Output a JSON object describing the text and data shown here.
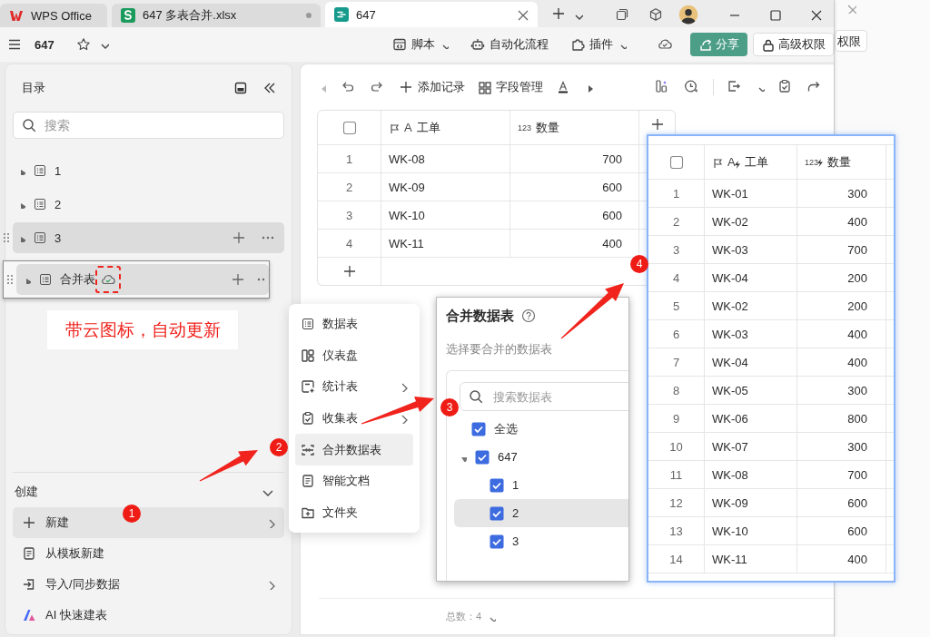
{
  "tabs": [
    {
      "kind": "home",
      "label": "WPS Office",
      "selected": false
    },
    {
      "kind": "sheet",
      "label": "647 多表合并.xlsx",
      "selected": false
    },
    {
      "kind": "base",
      "label": "647",
      "selected": true
    }
  ],
  "header": {
    "title": "647",
    "actions": [
      {
        "kind": "script",
        "label": "脚本",
        "dropdown": true
      },
      {
        "kind": "robot",
        "label": "自动化流程",
        "dropdown": false
      },
      {
        "kind": "plugin",
        "label": "插件",
        "dropdown": true
      }
    ],
    "share": "分享",
    "permissions": "高级权限"
  },
  "background_window": {
    "button": "权限"
  },
  "sidebar": {
    "title": "目录",
    "search": {
      "placeholder": "搜索"
    },
    "items": [
      {
        "label": "1",
        "selected": false
      },
      {
        "label": "2",
        "selected": false
      },
      {
        "label": "3",
        "selected": true
      }
    ],
    "create": {
      "title": "创建",
      "items": [
        {
          "kind": "plus",
          "label": "新建",
          "submenu": true,
          "selected": true
        },
        {
          "kind": "template",
          "label": "从模板新建",
          "submenu": false,
          "selected": false
        },
        {
          "kind": "import",
          "label": "导入/同步数据",
          "submenu": true,
          "selected": false
        },
        {
          "kind": "ai",
          "label": "AI 快速建表",
          "submenu": false,
          "selected": false
        }
      ]
    }
  },
  "dragged_item": {
    "label": "合并表",
    "synced": true
  },
  "annotation": "带云图标，自动更新",
  "view_toolbar": {
    "add_record": "添加记录",
    "fields": "字段管理"
  },
  "table": {
    "columns": [
      {
        "kind": "text",
        "type_label": "A",
        "label": "工单"
      },
      {
        "kind": "number",
        "type_label": "123",
        "label": "数量"
      }
    ],
    "rows": [
      {
        "index": "1",
        "cells": [
          "WK-08",
          "700"
        ]
      },
      {
        "index": "2",
        "cells": [
          "WK-09",
          "600"
        ]
      },
      {
        "index": "3",
        "cells": [
          "WK-10",
          "600"
        ]
      },
      {
        "index": "4",
        "cells": [
          "WK-11",
          "400"
        ]
      }
    ]
  },
  "footer": {
    "total": "总数：4"
  },
  "new_menu": {
    "items": [
      {
        "kind": "sheet",
        "label": "数据表",
        "submenu": false,
        "selected": false
      },
      {
        "kind": "dashboard",
        "label": "仪表盘",
        "submenu": false,
        "selected": false
      },
      {
        "kind": "stats",
        "label": "统计表",
        "submenu": true,
        "selected": false
      },
      {
        "kind": "form",
        "label": "收集表",
        "submenu": true,
        "selected": false
      },
      {
        "kind": "merge",
        "label": "合并数据表",
        "submenu": false,
        "selected": true
      },
      {
        "kind": "doc",
        "label": "智能文档",
        "submenu": false,
        "selected": false
      },
      {
        "kind": "folder",
        "label": "文件夹",
        "submenu": false,
        "selected": false
      }
    ]
  },
  "merge_dialog": {
    "title": "合并数据表",
    "hint": "选择要合并的数据表",
    "search": {
      "placeholder": "搜索数据表"
    },
    "select_all": {
      "label": "全选",
      "checked": true
    },
    "tree": [
      {
        "label": "647",
        "checked": true,
        "expanded": true,
        "selected": false,
        "children": [
          {
            "label": "1",
            "checked": true,
            "selected": false
          },
          {
            "label": "2",
            "checked": true,
            "selected": true
          },
          {
            "label": "3",
            "checked": true,
            "selected": false
          }
        ]
      }
    ]
  },
  "merged_table": {
    "synced": true,
    "columns": [
      {
        "kind": "text",
        "type_label": "A",
        "label": "工单"
      },
      {
        "kind": "number",
        "type_label": "123",
        "label": "数量"
      }
    ],
    "rows": [
      {
        "index": "1",
        "cells": [
          "WK-01",
          "300"
        ]
      },
      {
        "index": "2",
        "cells": [
          "WK-02",
          "400"
        ]
      },
      {
        "index": "3",
        "cells": [
          "WK-03",
          "700"
        ]
      },
      {
        "index": "4",
        "cells": [
          "WK-04",
          "200"
        ]
      },
      {
        "index": "5",
        "cells": [
          "WK-02",
          "200"
        ]
      },
      {
        "index": "6",
        "cells": [
          "WK-03",
          "400"
        ]
      },
      {
        "index": "7",
        "cells": [
          "WK-04",
          "400"
        ]
      },
      {
        "index": "8",
        "cells": [
          "WK-05",
          "300"
        ]
      },
      {
        "index": "9",
        "cells": [
          "WK-06",
          "800"
        ]
      },
      {
        "index": "10",
        "cells": [
          "WK-07",
          "300"
        ]
      },
      {
        "index": "11",
        "cells": [
          "WK-08",
          "700"
        ]
      },
      {
        "index": "12",
        "cells": [
          "WK-09",
          "600"
        ]
      },
      {
        "index": "13",
        "cells": [
          "WK-10",
          "600"
        ]
      },
      {
        "index": "14",
        "cells": [
          "WK-11",
          "400"
        ]
      }
    ]
  },
  "steps": [
    "1",
    "2",
    "3",
    "4"
  ]
}
